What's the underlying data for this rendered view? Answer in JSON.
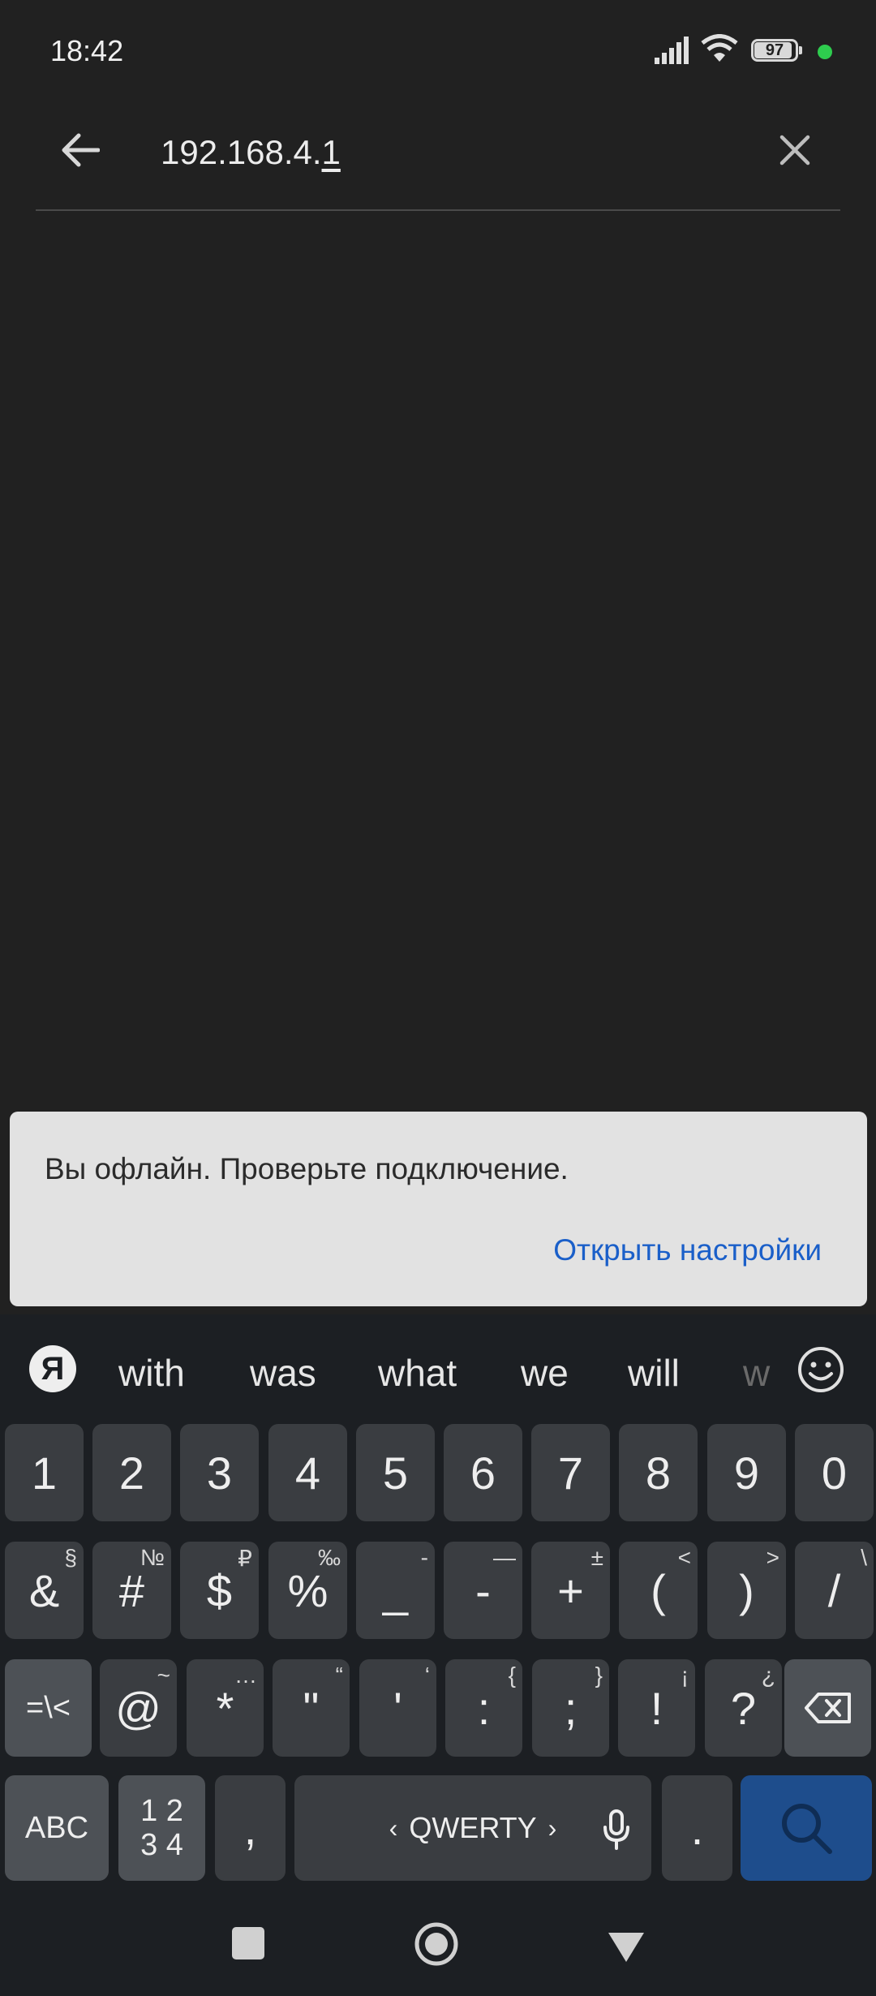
{
  "status_bar": {
    "time": "18:42",
    "battery": "97"
  },
  "search": {
    "url_main": "192.168.4.",
    "url_underlined": "1"
  },
  "snackbar": {
    "message": "Вы офлайн. Проверьте подключение.",
    "action": "Открыть настройки"
  },
  "keyboard": {
    "logo": "Я",
    "suggestions": [
      "with",
      "was",
      "what",
      "we",
      "will",
      "w"
    ],
    "row1": [
      "1",
      "2",
      "3",
      "4",
      "5",
      "6",
      "7",
      "8",
      "9",
      "0"
    ],
    "row2": [
      {
        "k": "&",
        "s": "§"
      },
      {
        "k": "#",
        "s": "№"
      },
      {
        "k": "$",
        "s": "₽"
      },
      {
        "k": "%",
        "s": "‰"
      },
      {
        "k": "_",
        "s": "-"
      },
      {
        "k": "-",
        "s": "—"
      },
      {
        "k": "+",
        "s": "±"
      },
      {
        "k": "(",
        "s": "<"
      },
      {
        "k": ")",
        "s": ">"
      },
      {
        "k": "/",
        "s": "\\"
      }
    ],
    "row3": [
      {
        "k": "@",
        "s": "~"
      },
      {
        "k": "*",
        "s": "…"
      },
      {
        "k": "\"",
        "s": "“"
      },
      {
        "k": "'",
        "s": "‘"
      },
      {
        "k": ":",
        "s": "{"
      },
      {
        "k": ";",
        "s": "}"
      },
      {
        "k": "!",
        "s": "¡"
      },
      {
        "k": "?",
        "s": "¿"
      }
    ],
    "shift_label": "=\\<",
    "abc_label": "ABC",
    "num_label_top": "1 2",
    "num_label_bottom": "3 4",
    "comma": ",",
    "space_label": "QWERTY",
    "period": ".",
    "colors": {
      "key": "#3a3d41",
      "func_key": "#4d5156",
      "search_key": "#1e4d8c",
      "background": "#1c1f23"
    }
  },
  "icons": {
    "back": "arrow-left-icon",
    "clear": "close-icon",
    "mic": "microphone-icon",
    "search": "search-icon",
    "backspace": "backspace-icon",
    "emoji": "smiley-icon"
  },
  "colors": {
    "background": "#212121",
    "snackbar": "#e2e2e2",
    "action": "#1a5fc9"
  }
}
